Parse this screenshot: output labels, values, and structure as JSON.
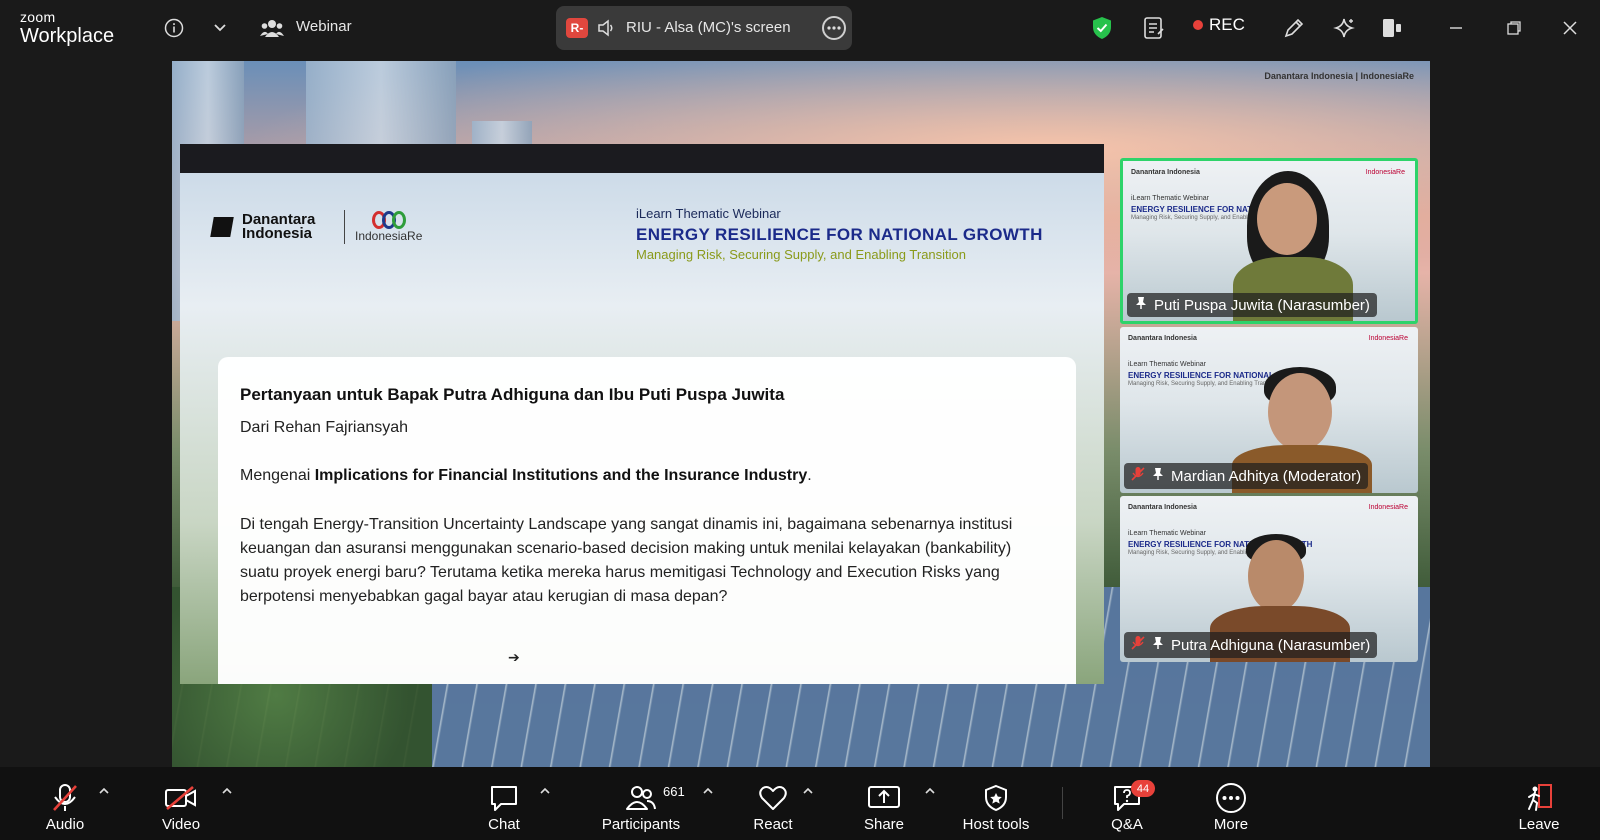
{
  "app": {
    "brand_line1": "zoom",
    "brand_line2": "Workplace",
    "meeting_type": "Webinar",
    "share_badge": "R-",
    "share_name": "RIU - Alsa (MC)'s screen",
    "rec_label": "REC"
  },
  "slide": {
    "logo_danantara": "Danantara Indonesia",
    "logo_indonesiare": "IndonesiaRe",
    "kicker": "iLearn Thematic Webinar",
    "title": "ENERGY RESILIENCE FOR NATIONAL GROWTH",
    "subtitle": "Managing Risk, Securing Supply, and Enabling Transition",
    "question": {
      "title": "Pertanyaan untuk Bapak Putra Adhiguna dan Ibu Puti Puspa Juwita",
      "from": "Dari Rehan Fajriansyah",
      "topic_prefix": "Mengenai",
      "topic_bold": "Implications for Financial Institutions and the Insurance Industry",
      "topic_suffix": ".",
      "body": "Di tengah Energy-Transition Uncertainty Landscape yang sangat dinamis ini, bagaimana sebenarnya institusi keuangan dan asuransi menggunakan scenario-based decision making untuk menilai kelayakan (bankability) suatu proyek energi baru? Terutama ketika mereka harus memitigasi Technology and Execution Risks yang berpotensi menyebabkan gagal bayar atau kerugian di masa depan?"
    }
  },
  "participants_tiles": [
    {
      "name": "Puti Puspa Juwita (Narasumber)",
      "muted": false,
      "active": true
    },
    {
      "name": "Mardian Adhitya (Moderator)",
      "muted": true,
      "active": false
    },
    {
      "name": "Putra Adhiguna (Narasumber)",
      "muted": true,
      "active": false
    }
  ],
  "toolbar": {
    "audio": "Audio",
    "video": "Video",
    "chat": "Chat",
    "participants": "Participants",
    "participants_count": "661",
    "react": "React",
    "share": "Share",
    "host_tools": "Host tools",
    "qa": "Q&A",
    "qa_badge": "44",
    "more": "More",
    "leave": "Leave"
  },
  "colors": {
    "accent_green": "#2ed36a",
    "rec_red": "#e8413a",
    "slide_title_blue": "#1b2a8a",
    "slide_subtitle_olive": "#8a9a1a"
  }
}
